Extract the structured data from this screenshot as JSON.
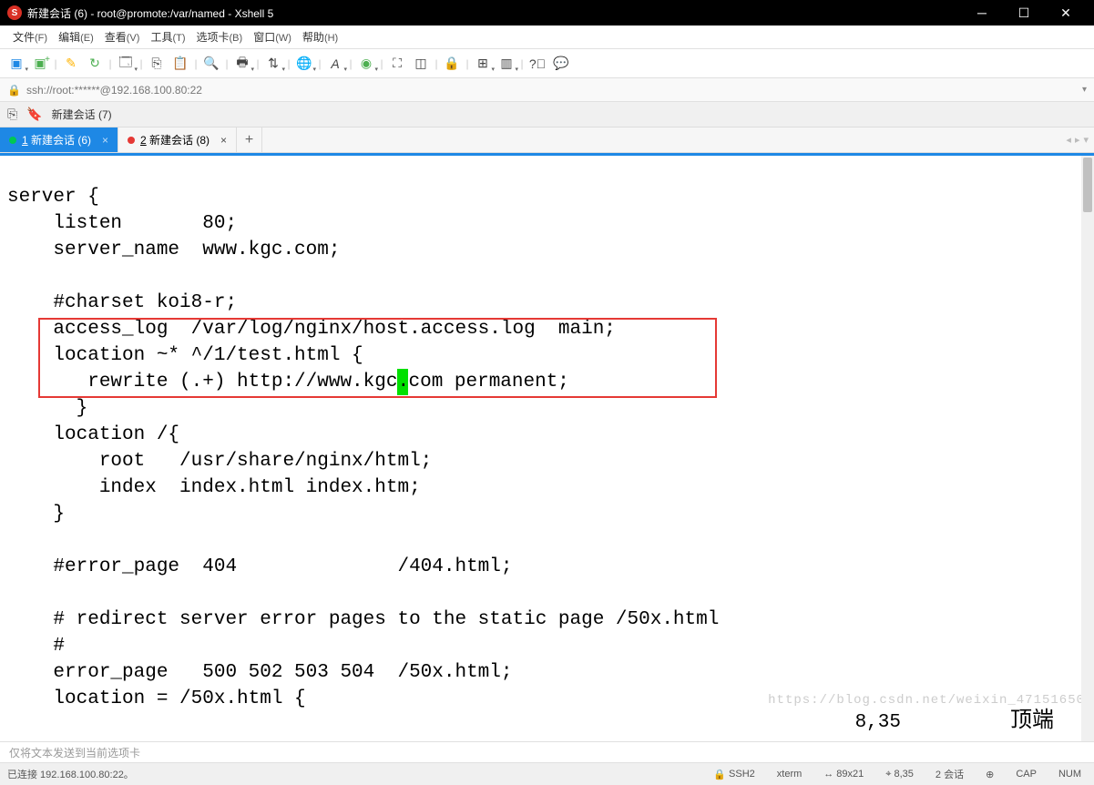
{
  "titlebar": {
    "title": "新建会话 (6) - root@promote:/var/named - Xshell 5"
  },
  "menubar": {
    "items": [
      {
        "label": "文件",
        "hk": "(F)"
      },
      {
        "label": "编辑",
        "hk": "(E)"
      },
      {
        "label": "查看",
        "hk": "(V)"
      },
      {
        "label": "工具",
        "hk": "(T)"
      },
      {
        "label": "选项卡",
        "hk": "(B)"
      },
      {
        "label": "窗口",
        "hk": "(W)"
      },
      {
        "label": "帮助",
        "hk": "(H)"
      }
    ]
  },
  "addrbar": {
    "url": "ssh://root:******@192.168.100.80:22"
  },
  "sessionbar": {
    "label": "新建会话 (7)"
  },
  "tabs": {
    "active": {
      "num": "1",
      "label": "新建会话 (6)"
    },
    "other": {
      "num": "2",
      "label": "新建会话 (8)"
    }
  },
  "terminal": {
    "lines": [
      "server {",
      "    listen       80;",
      "    server_name  www.kgc.com;",
      "",
      "    #charset koi8-r;",
      "    access_log  /var/log/nginx/host.access.log  main;",
      "    location ~* ^/1/test.html {",
      "       rewrite (.+) http://www.kgc",
      "com permanent;",
      "      }",
      "    location /{",
      "        root   /usr/share/nginx/html;",
      "        index  index.html index.htm;",
      "    }",
      "",
      "    #error_page  404              /404.html;",
      "",
      "    # redirect server error pages to the static page /50x.html",
      "    #",
      "    error_page   500 502 503 504  /50x.html;",
      "    location = /50x.html {"
    ],
    "cursor_char": ".",
    "position": "8,35",
    "toplabel": "顶端"
  },
  "infobar": {
    "text": "仅将文本发送到当前选项卡"
  },
  "statusbar": {
    "left": "已连接 192.168.100.80:22。",
    "ssh": "SSH2",
    "term": "xterm",
    "size": "89x21",
    "pos": "8,35",
    "sessions": "2 会话",
    "cap": "CAP",
    "num": "NUM"
  },
  "watermark": "https://blog.csdn.net/weixin_47151650"
}
